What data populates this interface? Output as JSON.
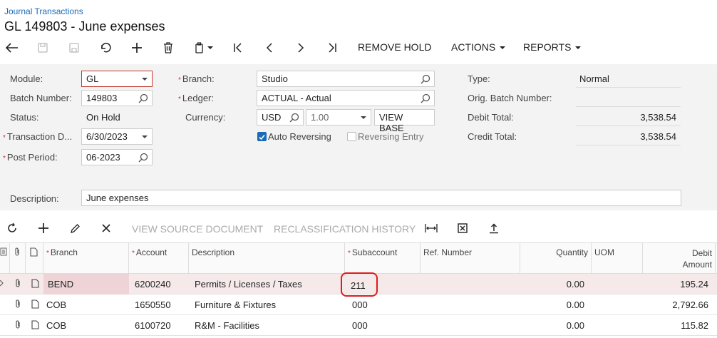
{
  "breadcrumb": "Journal Transactions",
  "title": "GL 149803 - June expenses",
  "toolbar": {
    "remove_hold": "REMOVE HOLD",
    "actions": "ACTIONS",
    "reports": "REPORTS"
  },
  "form": {
    "module_label": "Module:",
    "module_value": "GL",
    "batch_number_label": "Batch Number:",
    "batch_number_value": "149803",
    "status_label": "Status:",
    "status_value": "On Hold",
    "transaction_date_label": "Transaction D...",
    "transaction_date_value": "6/30/2023",
    "post_period_label": "Post Period:",
    "post_period_value": "06-2023",
    "branch_label": "Branch:",
    "branch_value": "Studio",
    "ledger_label": "Ledger:",
    "ledger_value": "ACTUAL - Actual",
    "currency_label": "Currency:",
    "currency_value": "USD",
    "currency_rate": "1.00",
    "view_base": "VIEW BASE",
    "auto_reversing": "Auto Reversing",
    "reversing_entry": "Reversing Entry",
    "type_label": "Type:",
    "type_value": "Normal",
    "orig_batch_label": "Orig. Batch Number:",
    "orig_batch_value": "",
    "debit_total_label": "Debit Total:",
    "debit_total_value": "3,538.54",
    "credit_total_label": "Credit Total:",
    "credit_total_value": "3,538.54",
    "description_label": "Description:",
    "description_value": "June expenses"
  },
  "grid_toolbar": {
    "view_source": "VIEW SOURCE DOCUMENT",
    "reclass_history": "RECLASSIFICATION HISTORY"
  },
  "grid": {
    "headers": {
      "branch": "Branch",
      "account": "Account",
      "description": "Description",
      "subaccount": "Subaccount",
      "ref_number": "Ref. Number",
      "quantity": "Quantity",
      "uom": "UOM",
      "debit_amount_line1": "Debit",
      "debit_amount_line2": "Amount"
    },
    "rows": [
      {
        "branch": "BEND",
        "account": "6200240",
        "description": "Permits / Licenses / Taxes",
        "subaccount": "211",
        "ref": "",
        "quantity": "0.00",
        "uom": "",
        "debit": "195.24"
      },
      {
        "branch": "COB",
        "account": "1650550",
        "description": "Furniture & Fixtures",
        "subaccount": "000",
        "ref": "",
        "quantity": "0.00",
        "uom": "",
        "debit": "2,792.66"
      },
      {
        "branch": "COB",
        "account": "6100720",
        "description": "R&M - Facilities",
        "subaccount": "000",
        "ref": "",
        "quantity": "0.00",
        "uom": "",
        "debit": "115.82"
      }
    ]
  }
}
